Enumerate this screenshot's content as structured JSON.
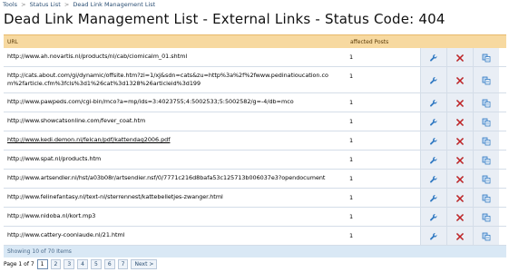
{
  "breadcrumb": [
    {
      "label": "Tools"
    },
    {
      "label": "Status List"
    },
    {
      "label": "Dead Link Management List"
    }
  ],
  "page_title": "Dead Link Management List - External Links - Status Code: 404",
  "table": {
    "columns": {
      "url": "URL",
      "affected": "affected Posts"
    },
    "rows": [
      {
        "url": "http://www.ah.novartis.nl/products/nl/cab/ciomicalm_01.shtml",
        "affected": "1",
        "underline": false
      },
      {
        "url": "http://cats.about.com/gi/dynamic/offsite.htm?zi=1/xJ&sdn=cats&zu=http%3a%2f%2fwww.pedinatioucation.com%2farticle.cfm%3fcls%3d1%26cat%3d1328%26articleid%3d199",
        "affected": "1",
        "underline": false
      },
      {
        "url": "http://www.pawpeds.com/cgi-bin/mco?a=mp/ids=3:4023755;4:5002533;5:5002582/g=-4/db=mco",
        "affected": "1",
        "underline": false
      },
      {
        "url": "http://www.showcatsonline.com/fever_coat.htm",
        "affected": "1",
        "underline": false
      },
      {
        "url": "http://www.kedi.demon.nl/felcan/pdf/kattendag2006.pdf",
        "affected": "1",
        "underline": true
      },
      {
        "url": "http://www.spat.nl/products.htm",
        "affected": "1",
        "underline": false
      },
      {
        "url": "http://www.artsendler.nl/hst/a03b08r/artsendier.nsf/0/7771c216d8bafa53c125713b006037e3?opendocument",
        "affected": "1",
        "underline": false
      },
      {
        "url": "http://www.felinefantasy.nl/text-nl/sterrennest/kattebelletjes-zwanger.html",
        "affected": "1",
        "underline": false
      },
      {
        "url": "http://www.nidoba.nl/kort.mp3",
        "affected": "1",
        "underline": false
      },
      {
        "url": "http://www.cattery-coonlaude.nl/21.html",
        "affected": "1",
        "underline": false
      }
    ],
    "footer": "Showing 10 of 70 Items"
  },
  "icons": {
    "edit": "wrench-icon",
    "delete": "red-x-icon",
    "copy": "copy-icon"
  },
  "colors": {
    "header_bg": "#f7d9a0",
    "action_bg": "#e9eef5",
    "footer_bg": "#d9e8f5",
    "delete_red": "#d6191c",
    "tool_blue": "#2f78c2"
  },
  "pager": {
    "label": "Page 1 of 7",
    "pages": [
      "1",
      "2",
      "3",
      "4",
      "5",
      "6",
      "7"
    ],
    "current": "1",
    "next": "Next >"
  }
}
